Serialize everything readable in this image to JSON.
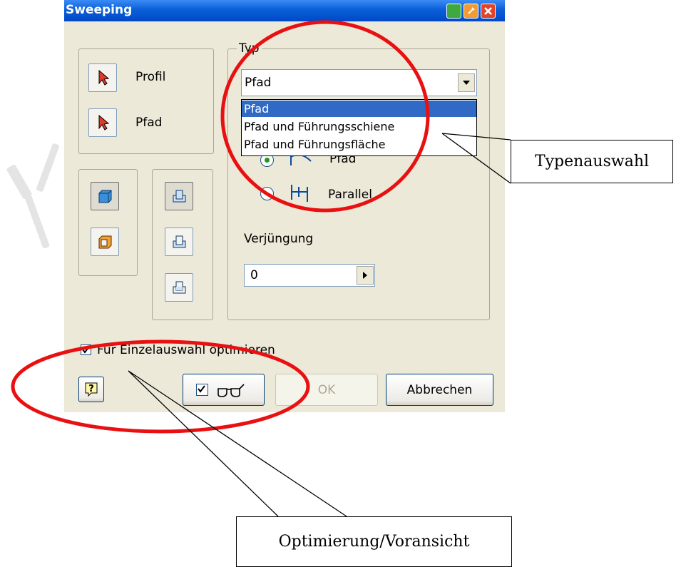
{
  "dialog": {
    "title": "Sweeping"
  },
  "shape_group": {
    "profile_label": "Profil",
    "path_label": "Pfad"
  },
  "type_group": {
    "legend": "Typ",
    "selected": "Pfad",
    "options": [
      "Pfad",
      "Pfad und Führungsschiene",
      "Pfad und Führungsfläche"
    ],
    "radio_path_label": "Pfad",
    "radio_parallel_label": "Parallel",
    "taper_label": "Verjüngung",
    "taper_value": "0"
  },
  "optimize_checkbox": {
    "label": "Für Einzelauswahl optimieren",
    "checked": true
  },
  "buttons": {
    "ok": "OK",
    "cancel": "Abbrechen"
  },
  "annotations": {
    "type_callout": "Typenauswahl",
    "optimize_callout": "Optimierung/Voransicht"
  },
  "colors": {
    "title_bar": "#0a5fd8",
    "selection": "#316ac5",
    "highlight_ellipse": "#e81010"
  }
}
